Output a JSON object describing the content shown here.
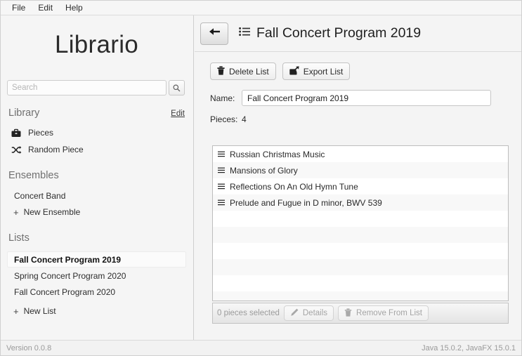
{
  "menubar": {
    "items": [
      {
        "label": "File",
        "name": "menu-file"
      },
      {
        "label": "Edit",
        "name": "menu-edit"
      },
      {
        "label": "Help",
        "name": "menu-help"
      }
    ]
  },
  "sidebar": {
    "brand": "Librario",
    "search": {
      "value": "",
      "placeholder": "Search",
      "icon": "search-icon"
    },
    "library": {
      "title": "Library",
      "edit_label": "Edit",
      "items": [
        {
          "label": "Pieces",
          "icon": "briefcase-icon"
        },
        {
          "label": "Random Piece",
          "icon": "shuffle-icon"
        }
      ]
    },
    "ensembles": {
      "title": "Ensembles",
      "items": [
        {
          "label": "Concert Band"
        }
      ],
      "add_label": "New Ensemble"
    },
    "lists": {
      "title": "Lists",
      "items": [
        {
          "label": "Fall Concert Program 2019",
          "selected": true
        },
        {
          "label": "Spring Concert Program 2020",
          "selected": false
        },
        {
          "label": "Fall Concert Program 2020",
          "selected": false
        }
      ],
      "add_label": "New List"
    }
  },
  "main": {
    "back_button": {
      "icon": "arrow-left-icon"
    },
    "title_icon": "list-icon",
    "title": "Fall Concert Program 2019",
    "toolbar": [
      {
        "label": "Delete List",
        "icon": "trash-icon"
      },
      {
        "label": "Export List",
        "icon": "export-icon"
      }
    ],
    "name_field": {
      "label": "Name:",
      "value": "Fall Concert Program 2019",
      "placeholder": ""
    },
    "pieces_count": {
      "label": "Pieces:",
      "value": "4"
    },
    "pieces": [
      {
        "title": "Russian Christmas Music",
        "handle_icon": "drag-handle-icon"
      },
      {
        "title": "Mansions of Glory",
        "handle_icon": "drag-handle-icon"
      },
      {
        "title": "Reflections On An Old Hymn Tune",
        "handle_icon": "drag-handle-icon"
      },
      {
        "title": "Prelude and Fugue in D minor, BWV 539",
        "handle_icon": "drag-handle-icon"
      }
    ],
    "bottom_bar": {
      "selection_text": "0 pieces selected",
      "details_label": "Details",
      "details_icon": "pencil-icon",
      "remove_label": "Remove From List",
      "remove_icon": "trash-icon"
    }
  },
  "statusbar": {
    "version": "Version 0.0.8",
    "runtime": "Java 15.0.2, JavaFX 15.0.1"
  },
  "colors": {
    "window_bg": "#f4f4f4",
    "sidebar_bg": "#f5f5f5",
    "text": "#2a2a2a",
    "muted": "#9a9a9a",
    "border": "#cfcfcf"
  }
}
